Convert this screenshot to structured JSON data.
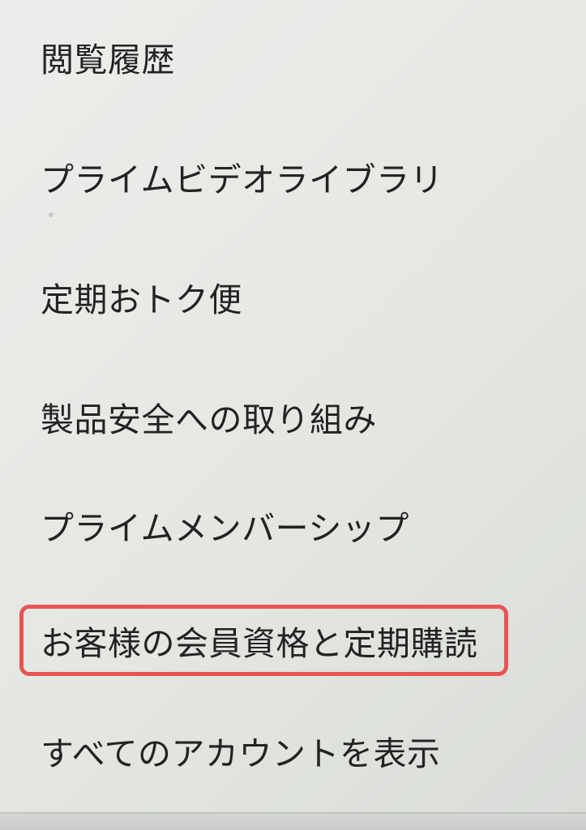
{
  "menu": {
    "items": [
      {
        "label": "閲覧履歴"
      },
      {
        "label": "プライムビデオライブラリ"
      },
      {
        "label": "定期おトク便"
      },
      {
        "label": "製品安全への取り組み"
      },
      {
        "label": "プライムメンバーシップ"
      },
      {
        "label": "お客様の会員資格と定期購読"
      },
      {
        "label": "すべてのアカウントを表示"
      }
    ],
    "highlighted_index": 5
  },
  "colors": {
    "text": "#232323",
    "highlight_border": "#e85454",
    "background": "#e6e8e4"
  }
}
